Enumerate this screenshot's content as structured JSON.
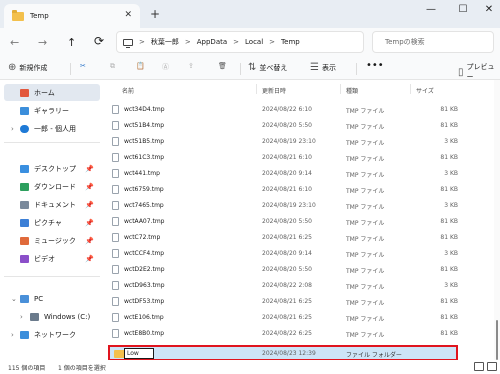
{
  "window": {
    "tab_title": "Temp",
    "close_glyph": "✕",
    "newtab_glyph": "+",
    "min_glyph": "—",
    "max_glyph": "☐",
    "winclose_glyph": "✕"
  },
  "nav": {
    "back": "←",
    "forward": "→",
    "up": "↑",
    "refresh": "⟳"
  },
  "breadcrumb": [
    "秋葉一郎",
    "AppData",
    "Local",
    "Temp"
  ],
  "breadcrumb_sep": ">",
  "search": {
    "placeholder": "Tempの検索"
  },
  "toolbar": {
    "new_label": "新規作成",
    "new_icon": "⊕",
    "cut_icon": "✂",
    "copy_icon": "⧉",
    "paste_icon": "📋",
    "rename_icon": "Ⓐ",
    "share_icon": "⇪",
    "delete_icon": "🗑",
    "sort_label": "並べ替え",
    "sort_icon": "⇅",
    "view_label": "表示",
    "view_icon": "☰",
    "more_label": "•••",
    "preview_label": "プレビュー",
    "preview_icon": "▯"
  },
  "sidebar": {
    "items": [
      {
        "label": "ホーム",
        "icon": "home-icon"
      },
      {
        "label": "ギャラリー",
        "icon": "gallery-icon"
      },
      {
        "label": "一郎 - 個人用",
        "icon": "onedrive-icon"
      },
      {
        "label": "デスクトップ",
        "icon": "desktop-icon",
        "pinned": true
      },
      {
        "label": "ダウンロード",
        "icon": "download-icon",
        "pinned": true
      },
      {
        "label": "ドキュメント",
        "icon": "documents-icon",
        "pinned": true
      },
      {
        "label": "ピクチャ",
        "icon": "pictures-icon",
        "pinned": true
      },
      {
        "label": "ミュージック",
        "icon": "music-icon",
        "pinned": true
      },
      {
        "label": "ビデオ",
        "icon": "videos-icon",
        "pinned": true
      },
      {
        "label": "PC",
        "icon": "pc-icon"
      },
      {
        "label": "Windows (C:)",
        "icon": "drive-icon"
      },
      {
        "label": "ネットワーク",
        "icon": "network-icon"
      }
    ],
    "pin_glyph": "📌",
    "chev_right": "›",
    "chev_down": "⌄"
  },
  "columns": {
    "name": "名前",
    "date": "更新日時",
    "type": "種類",
    "size": "サイズ"
  },
  "files": [
    {
      "name": "wct34D4.tmp",
      "date": "2024/08/22 6:10",
      "type": "TMP ファイル",
      "size": "81 KB"
    },
    {
      "name": "wct51B4.tmp",
      "date": "2024/08/20 5:50",
      "type": "TMP ファイル",
      "size": "81 KB"
    },
    {
      "name": "wct51B5.tmp",
      "date": "2024/08/19 23:10",
      "type": "TMP ファイル",
      "size": "3 KB"
    },
    {
      "name": "wct61C3.tmp",
      "date": "2024/08/21 6:10",
      "type": "TMP ファイル",
      "size": "81 KB"
    },
    {
      "name": "wct441.tmp",
      "date": "2024/08/20 9:14",
      "type": "TMP ファイル",
      "size": "3 KB"
    },
    {
      "name": "wct6759.tmp",
      "date": "2024/08/21 6:10",
      "type": "TMP ファイル",
      "size": "81 KB"
    },
    {
      "name": "wct7465.tmp",
      "date": "2024/08/19 23:10",
      "type": "TMP ファイル",
      "size": "3 KB"
    },
    {
      "name": "wctAA07.tmp",
      "date": "2024/08/20 5:50",
      "type": "TMP ファイル",
      "size": "81 KB"
    },
    {
      "name": "wctC72.tmp",
      "date": "2024/08/21 6:25",
      "type": "TMP ファイル",
      "size": "81 KB"
    },
    {
      "name": "wctCCF4.tmp",
      "date": "2024/08/20 9:14",
      "type": "TMP ファイル",
      "size": "3 KB"
    },
    {
      "name": "wctD2E2.tmp",
      "date": "2024/08/20 5:50",
      "type": "TMP ファイル",
      "size": "81 KB"
    },
    {
      "name": "wctD963.tmp",
      "date": "2024/08/22 2:08",
      "type": "TMP ファイル",
      "size": "3 KB"
    },
    {
      "name": "wctDF53.tmp",
      "date": "2024/08/21 6:25",
      "type": "TMP ファイル",
      "size": "81 KB"
    },
    {
      "name": "wctE106.tmp",
      "date": "2024/08/21 6:25",
      "type": "TMP ファイル",
      "size": "81 KB"
    },
    {
      "name": "wctE8B0.tmp",
      "date": "2024/08/22 6:25",
      "type": "TMP ファイル",
      "size": "81 KB"
    }
  ],
  "new_folder": {
    "name": "Low",
    "date": "2024/08/23 12:39",
    "type": "ファイル フォルダー"
  },
  "status": {
    "count": "115 個の項目",
    "selected": "1 個の項目を選択"
  },
  "colors": {
    "selection": "#cde4f7",
    "highlight_border": "#e0141e",
    "folder": "#f3c04c"
  }
}
